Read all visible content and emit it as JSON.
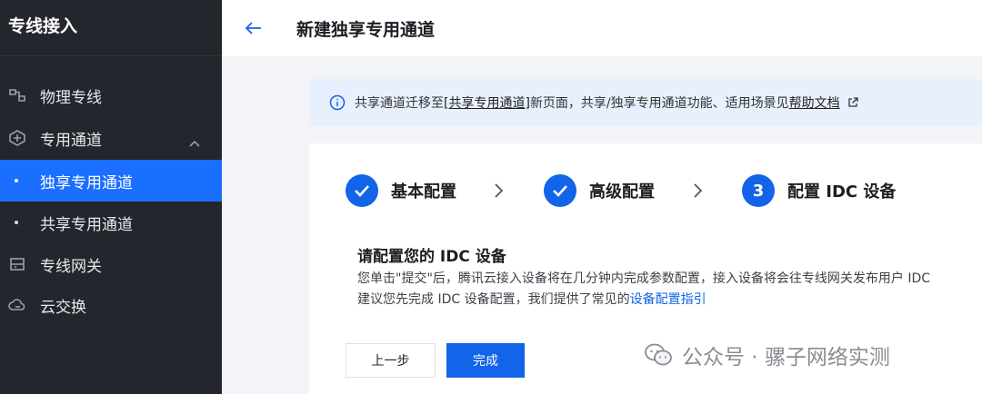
{
  "sidebar": {
    "title": "专线接入",
    "items": [
      {
        "label": "物理专线",
        "icon": "physical-line-icon"
      },
      {
        "label": "专用通道",
        "icon": "dedicated-tunnel-icon",
        "expanded": true
      },
      {
        "label": "独享专用通道",
        "sub": true,
        "active": true
      },
      {
        "label": "共享专用通道",
        "sub": true
      },
      {
        "label": "专线网关",
        "icon": "gateway-icon"
      },
      {
        "label": "云交换",
        "icon": "cloud-exchange-icon"
      }
    ]
  },
  "header": {
    "title": "新建独享专用通道"
  },
  "notice": {
    "text_1": "共享通道迁移至",
    "link_1": "[共享专用通道]",
    "text_2": "新页面，共享/独享专用通道功能、适用场景见",
    "link_2": "帮助文档"
  },
  "steps": [
    {
      "label": "基本配置",
      "status": "done"
    },
    {
      "label": "高级配置",
      "status": "done"
    },
    {
      "number": "3",
      "label": "配置 IDC 设备",
      "status": "current"
    }
  ],
  "section": {
    "title": "请配置您的 IDC 设备",
    "line_1": "您单击\"提交\"后，腾讯云接入设备将在几分钟内完成参数配置，接入设备将会往专线网关发布用户 IDC",
    "line_2_prefix": "建议您先完成 IDC 设备配置，我们提供了常见的",
    "line_2_link": "设备配置指引"
  },
  "buttons": {
    "prev": "上一步",
    "finish": "完成"
  },
  "watermark": {
    "text": "公众号 · 骡子网络实测"
  },
  "colors": {
    "sidebar_bg": "#23262c",
    "active_bg": "#1a6fff",
    "primary": "#1264e8",
    "notice_bg": "#e8f0fe"
  }
}
